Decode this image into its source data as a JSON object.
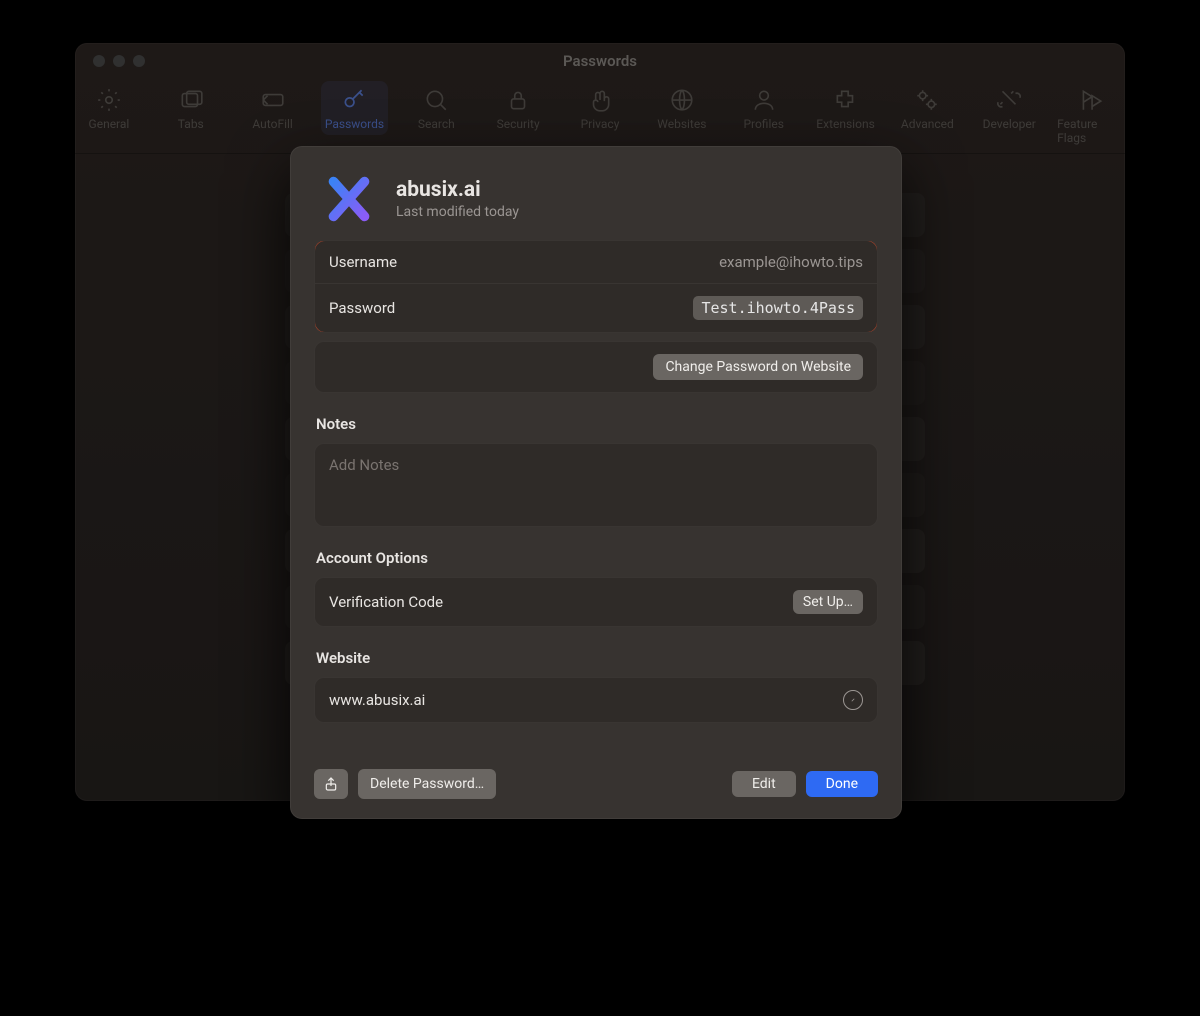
{
  "window": {
    "title": "Passwords"
  },
  "toolbar": {
    "items": [
      {
        "label": "General",
        "icon": "gear"
      },
      {
        "label": "Tabs",
        "icon": "tabs"
      },
      {
        "label": "AutoFill",
        "icon": "autofill"
      },
      {
        "label": "Passwords",
        "icon": "key",
        "selected": true
      },
      {
        "label": "Search",
        "icon": "search"
      },
      {
        "label": "Security",
        "icon": "lock"
      },
      {
        "label": "Privacy",
        "icon": "hand"
      },
      {
        "label": "Websites",
        "icon": "globe"
      },
      {
        "label": "Profiles",
        "icon": "person"
      },
      {
        "label": "Extensions",
        "icon": "puzzle"
      },
      {
        "label": "Advanced",
        "icon": "gears"
      },
      {
        "label": "Developer",
        "icon": "tools"
      },
      {
        "label": "Feature Flags",
        "icon": "flags"
      }
    ]
  },
  "entry": {
    "site_name": "abusix.ai",
    "last_modified": "Last modified today",
    "username_label": "Username",
    "username_value": "example@ihowto.tips",
    "password_label": "Password",
    "password_value": "Test.ihowto.4Pass",
    "change_password_label": "Change Password on Website",
    "notes_heading": "Notes",
    "notes_placeholder": "Add Notes",
    "account_options_heading": "Account Options",
    "verification_label": "Verification Code",
    "setup_label": "Set Up…",
    "website_heading": "Website",
    "website_value": "www.abusix.ai"
  },
  "footer": {
    "delete_label": "Delete Password…",
    "edit_label": "Edit",
    "done_label": "Done"
  }
}
